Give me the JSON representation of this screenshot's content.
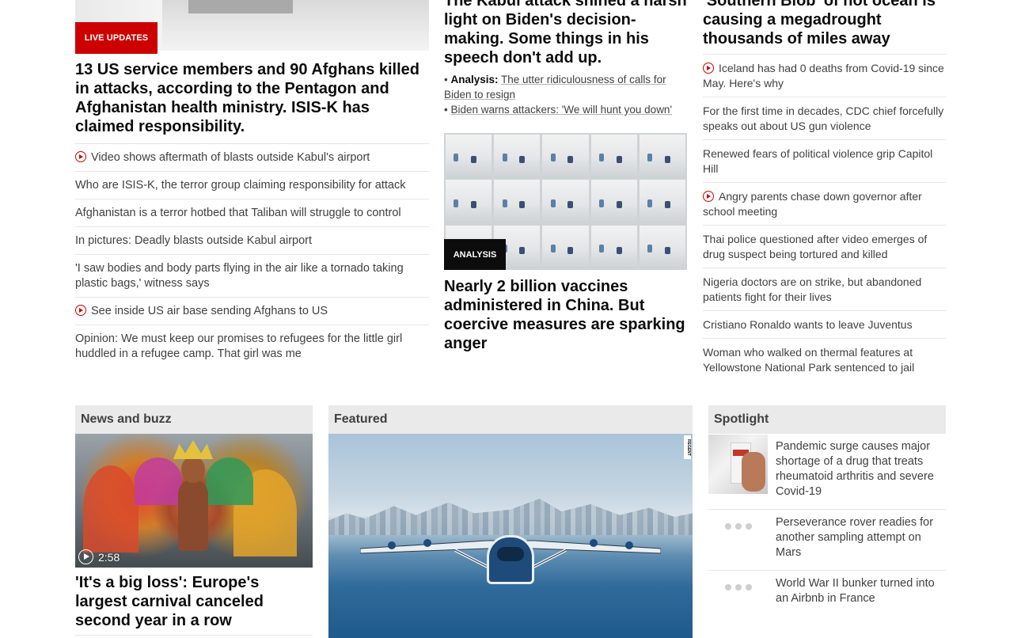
{
  "col1": {
    "badge": "LIVE UPDATES",
    "headline": "13 US service members and 90 Afghans killed in attacks, according to the Pentagon and Afghanistan health ministry. ISIS-K has claimed responsibility.",
    "links": [
      {
        "text": "Video shows aftermath of blasts outside Kabul's airport",
        "video": true
      },
      {
        "text": "Who are ISIS-K, the terror group claiming responsibility for attack",
        "video": false
      },
      {
        "text": "Afghanistan is a terror hotbed that Taliban will struggle to control",
        "video": false
      },
      {
        "text": "In pictures: Deadly blasts outside Kabul airport",
        "video": false
      },
      {
        "text": "'I saw bodies and body parts flying in the air like a tornado taking plastic bags,' witness says",
        "video": false
      },
      {
        "text": "See inside US air base sending Afghans to US",
        "video": true
      },
      {
        "text": "Opinion: We must keep our promises to refugees for the little girl huddled in a refugee camp. That girl was me",
        "video": false
      }
    ]
  },
  "col2": {
    "headline": "The Kabul attack shined a harsh light on Biden's decision-making. Some things in his speech don't add up.",
    "sub1_prefix": "Analysis:",
    "sub1_text": "The utter ridiculousness of calls for Biden to resign",
    "sub2_text": "Biden warns attackers: 'We will hunt you down'",
    "badge": "ANALYSIS",
    "headline2": "Nearly 2 billion vaccines administered in China. But coercive measures are sparking anger"
  },
  "col3": {
    "headline": "'Southern Blob' of hot ocean is causing a megadrought thousands of miles away",
    "links": [
      {
        "text": "Iceland has had 0 deaths from Covid-19 since May. Here's why",
        "video": true
      },
      {
        "text": "For the first time in decades, CDC chief forcefully speaks out about US gun violence",
        "video": false
      },
      {
        "text": "Renewed fears of political violence grip Capitol Hill",
        "video": false
      },
      {
        "text": "Angry parents chase down governor after school meeting",
        "video": true
      },
      {
        "text": "Thai police questioned after video emerges of drug suspect being tortured and killed",
        "video": false
      },
      {
        "text": "Nigeria doctors are on strike, but abandoned patients fight for their lives",
        "video": false
      },
      {
        "text": "Cristiano Ronaldo wants to leave Juventus",
        "video": false
      },
      {
        "text": "Woman who walked on thermal features at Yellowstone National Park sentenced to jail",
        "video": false
      }
    ]
  },
  "sections": {
    "news": "News and buzz",
    "featured": "Featured",
    "spotlight": "Spotlight"
  },
  "news": {
    "duration": "2:58",
    "headline": "'It's a big loss': Europe's largest carnival canceled second year in a row"
  },
  "featured": {
    "ad_tag": "REGENT"
  },
  "spotlight": [
    {
      "text": "Pandemic surge causes major shortage of a drug that treats rheumatoid arthritis and severe Covid-19"
    },
    {
      "text": "Perseverance rover readies for another sampling attempt on Mars"
    },
    {
      "text": "World War II bunker turned into an Airbnb in France"
    }
  ],
  "colors": {
    "live_red": "#cc0000",
    "analysis_black": "#0c0c0c",
    "section_bg": "#eaeaea"
  }
}
